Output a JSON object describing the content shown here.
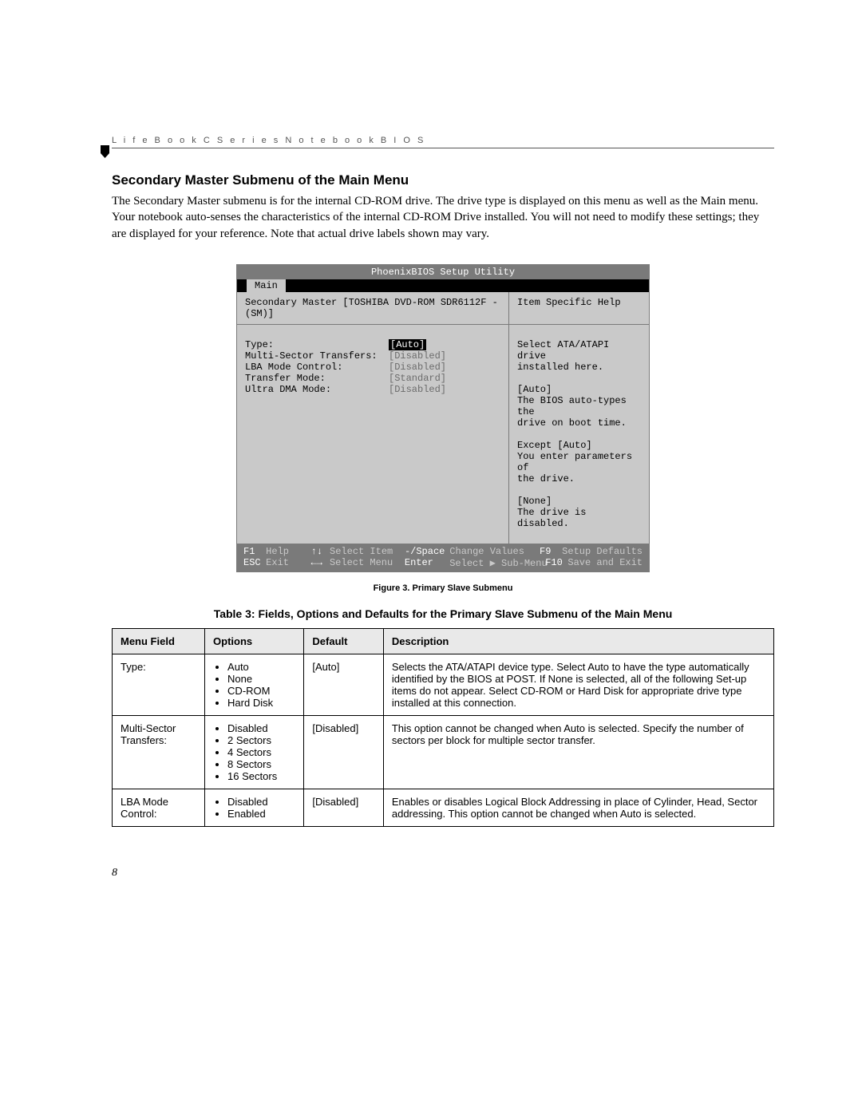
{
  "running_head": "L i f e B o o k   C   S e r i e s   N o t e b o o k   B I O S",
  "section_title": "Secondary Master Submenu of the Main Menu",
  "body_text": "The Secondary Master submenu is for the internal CD-ROM drive. The drive type is displayed on this menu as well as the Main menu. Your notebook auto-senses the characteristics of the internal CD-ROM Drive installed. You will not need to modify these settings; they are displayed for your reference. Note that actual drive labels shown may vary.",
  "bios": {
    "title": "PhoenixBIOS Setup Utility",
    "tab": "Main",
    "subhead_left": "Secondary Master [TOSHIBA DVD-ROM SDR6112F -(SM)]",
    "subhead_right": "Item Specific Help",
    "rows": [
      {
        "label": "Type:",
        "value": "[Auto]",
        "selected": true
      },
      {
        "label": "",
        "value": ""
      },
      {
        "label": "Multi-Sector Transfers:",
        "value": "[Disabled]"
      },
      {
        "label": "LBA Mode Control:",
        "value": "[Disabled]"
      },
      {
        "label": "Transfer Mode:",
        "value": "[Standard]"
      },
      {
        "label": "Ultra DMA Mode:",
        "value": "[Disabled]"
      }
    ],
    "help_text": "Select ATA/ATAPI drive\ninstalled here.\n\n[Auto]\nThe BIOS auto-types the\ndrive on boot time.\n\nExcept [Auto]\nYou enter parameters of\nthe drive.\n\n[None]\nThe drive is disabled.",
    "footer": {
      "f1": "F1",
      "help": "Help",
      "arrows_ud": "↑↓",
      "select_item": "Select Item",
      "minus_space": "-/Space",
      "change_values": "Change Values",
      "f9": "F9",
      "setup_defaults": "Setup Defaults",
      "esc": "ESC",
      "exit": "Exit",
      "arrows_lr": "←→",
      "select_menu": "Select Menu",
      "enter": "Enter",
      "select_sub": "Select ▶ Sub-Menu",
      "f10": "F10",
      "save_exit": "Save and Exit"
    }
  },
  "figure_caption": "Figure 3.  Primary Slave Submenu",
  "table_caption": "Table 3: Fields, Options and Defaults for the Primary Slave Submenu of the Main Menu",
  "table": {
    "headers": [
      "Menu Field",
      "Options",
      "Default",
      "Description"
    ],
    "rows": [
      {
        "field": "Type:",
        "options": [
          "Auto",
          "None",
          "CD-ROM",
          "Hard Disk"
        ],
        "default": "[Auto]",
        "description": "Selects the ATA/ATAPI device type. Select Auto to have the type automatically identified by the BIOS at POST. If None is selected, all of the following Set-up items do not appear. Select CD-ROM or Hard Disk for appropriate drive type installed at this connection."
      },
      {
        "field": "Multi-Sector Transfers:",
        "options": [
          "Disabled",
          "2 Sectors",
          "4 Sectors",
          "8 Sectors",
          "16 Sectors"
        ],
        "default": "[Disabled]",
        "description": "This option cannot be changed when Auto is selected. Specify the number of sectors per block for multiple sector transfer."
      },
      {
        "field": "LBA Mode Control:",
        "options": [
          "Disabled",
          "Enabled"
        ],
        "default": "[Disabled]",
        "description": "Enables or disables Logical Block Addressing in place of Cylinder, Head, Sector addressing. This option cannot be changed when Auto is selected."
      }
    ]
  },
  "page_number": "8"
}
